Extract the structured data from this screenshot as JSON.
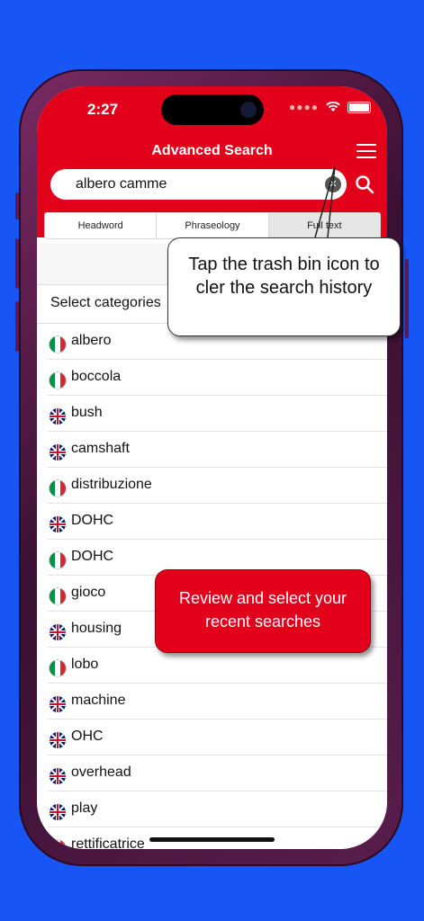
{
  "status_bar": {
    "time": "2:27"
  },
  "header": {
    "title": "Advanced Search",
    "accent_color": "#e3001b",
    "menu_icon": "hamburger-menu-icon"
  },
  "search": {
    "value": "albero camme",
    "clear_icon": "clear-circle-icon",
    "search_icon": "magnifier-icon"
  },
  "tabs": [
    {
      "label": "Headword"
    },
    {
      "label": "Phraseology"
    },
    {
      "label": "Full text",
      "selected": true
    }
  ],
  "categories": {
    "label": "Select categories"
  },
  "history": [
    {
      "term": "albero",
      "lang": "it"
    },
    {
      "term": "boccola",
      "lang": "it"
    },
    {
      "term": "bush",
      "lang": "en"
    },
    {
      "term": "camshaft",
      "lang": "en"
    },
    {
      "term": "distribuzione",
      "lang": "it"
    },
    {
      "term": "DOHC",
      "lang": "en"
    },
    {
      "term": "DOHC",
      "lang": "it"
    },
    {
      "term": "gioco",
      "lang": "it"
    },
    {
      "term": "housing",
      "lang": "en"
    },
    {
      "term": "lobo",
      "lang": "it"
    },
    {
      "term": "machine",
      "lang": "en"
    },
    {
      "term": "OHC",
      "lang": "en"
    },
    {
      "term": "overhead",
      "lang": "en"
    },
    {
      "term": "play",
      "lang": "en"
    },
    {
      "term": "rettificatrice",
      "lang": "it"
    }
  ],
  "callouts": {
    "trash_tip": "Tap the trash bin icon to cler the search history",
    "review_tip": "Review and select your recent searches"
  }
}
